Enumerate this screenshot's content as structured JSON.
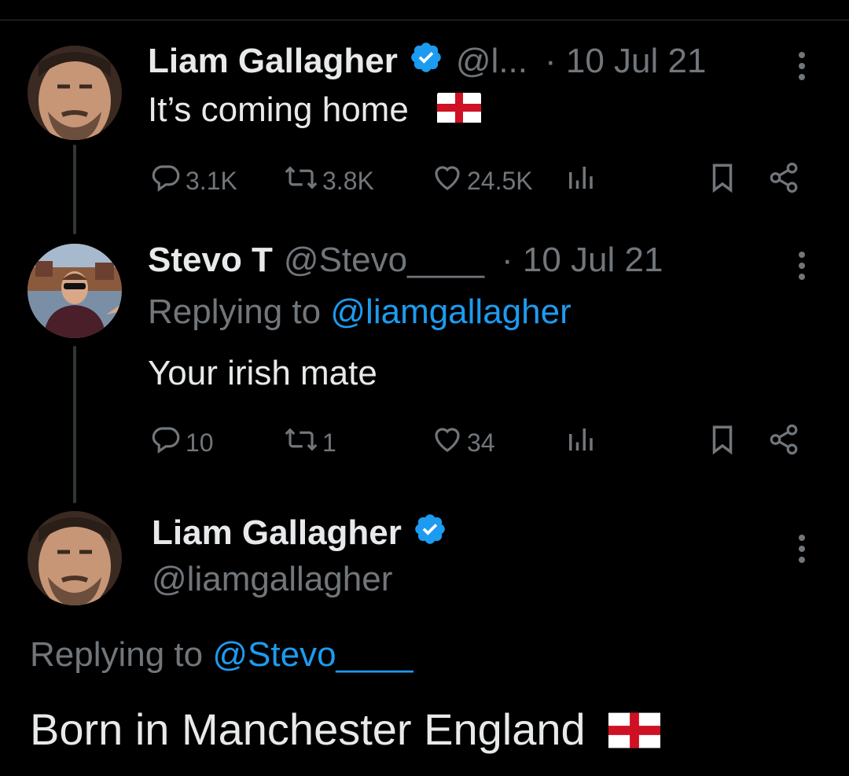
{
  "tweet1": {
    "name": "Liam Gallagher",
    "handle": "@l...",
    "date": "· 10 Jul 21",
    "text": "It’s coming home",
    "replies": "3.1K",
    "retweets": "3.8K",
    "likes": "24.5K"
  },
  "tweet2": {
    "name": "Stevo T",
    "handle": "@Stevo____",
    "date": "· 10 Jul 21",
    "replying_prefix": "Replying to",
    "replying_to": "@liamgallagher",
    "text": "Your irish mate",
    "replies": "10",
    "retweets": "1",
    "likes": "34"
  },
  "tweet3": {
    "name": "Liam Gallagher",
    "handle": "@liamgallagher",
    "replying_prefix": "Replying to",
    "replying_to": "@Stevo____",
    "text": "Born in Manchester England"
  },
  "colors": {
    "background": "#000000",
    "text": "#e7e9ea",
    "muted": "#71767b",
    "link": "#1d9bf0",
    "verified": "#1d9bf0"
  },
  "icons": [
    "verified-badge-icon",
    "more-icon",
    "reply-icon",
    "retweet-icon",
    "like-icon",
    "views-icon",
    "bookmark-icon",
    "share-icon",
    "england-flag-icon"
  ]
}
